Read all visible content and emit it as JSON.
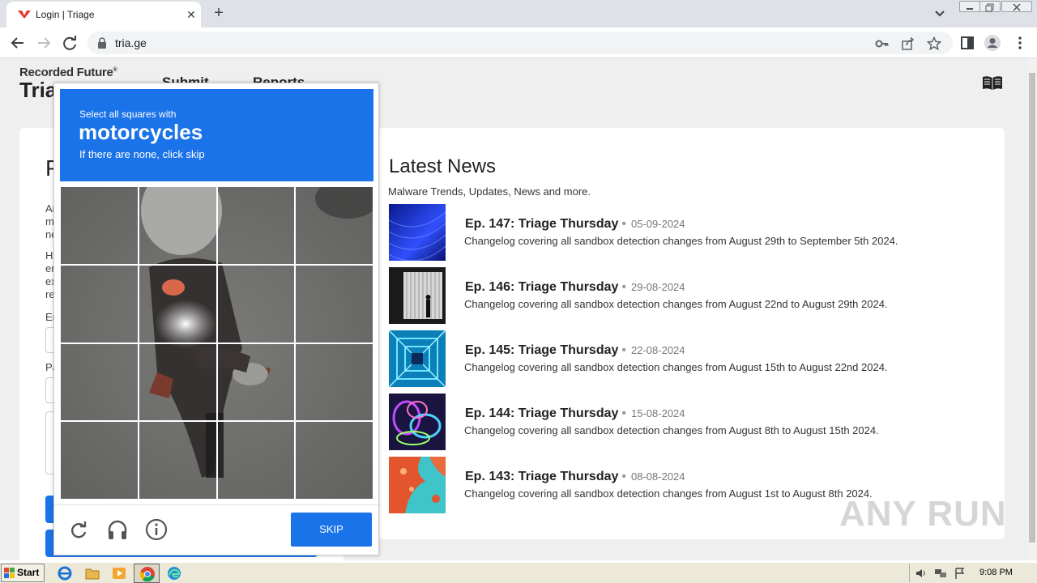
{
  "browser": {
    "tab_title": "Login | Triage",
    "tab_close": "✕",
    "new_tab": "+",
    "url": "tria.ge"
  },
  "site": {
    "brand_small": "Recorded Future",
    "brand_reg": "®",
    "brand_big": "Tria",
    "nav": [
      "Submit",
      "Reports"
    ]
  },
  "left_card": {
    "heading": "P",
    "lines": [
      "Ar",
      "m",
      "ne",
      "Hi",
      "er",
      "ex",
      "re",
      "Er",
      "Pa"
    ]
  },
  "news": {
    "title": "Latest News",
    "subtitle": "Malware Trends, Updates, News and more.",
    "separator": "•",
    "items": [
      {
        "title": "Ep. 147: Triage Thursday",
        "date": "05-09-2024",
        "desc": "Changelog covering all sandbox detection changes from August 29th to September 5th 2024."
      },
      {
        "title": "Ep. 146: Triage Thursday",
        "date": "29-08-2024",
        "desc": "Changelog covering all sandbox detection changes from August 22nd to August 29th 2024."
      },
      {
        "title": "Ep. 145: Triage Thursday",
        "date": "22-08-2024",
        "desc": "Changelog covering all sandbox detection changes from August 15th to August 22nd 2024."
      },
      {
        "title": "Ep. 144: Triage Thursday",
        "date": "15-08-2024",
        "desc": "Changelog covering all sandbox detection changes from August 8th to August 15th 2024."
      },
      {
        "title": "Ep. 143: Triage Thursday",
        "date": "08-08-2024",
        "desc": "Changelog covering all sandbox detection changes from August 1st to August 8th 2024."
      }
    ]
  },
  "captcha": {
    "instruction": "Select all squares with",
    "target": "motorcycles",
    "hint": "If there are none, click skip",
    "skip_label": "SKIP",
    "grid": "4x4"
  },
  "watermark": "ANY RUN",
  "taskbar": {
    "start_label": "Start",
    "clock": "9:08 PM"
  },
  "colors": {
    "accent": "#1a73e8",
    "tab_strip": "#dee1e6",
    "taskbar": "#ece9d8"
  }
}
